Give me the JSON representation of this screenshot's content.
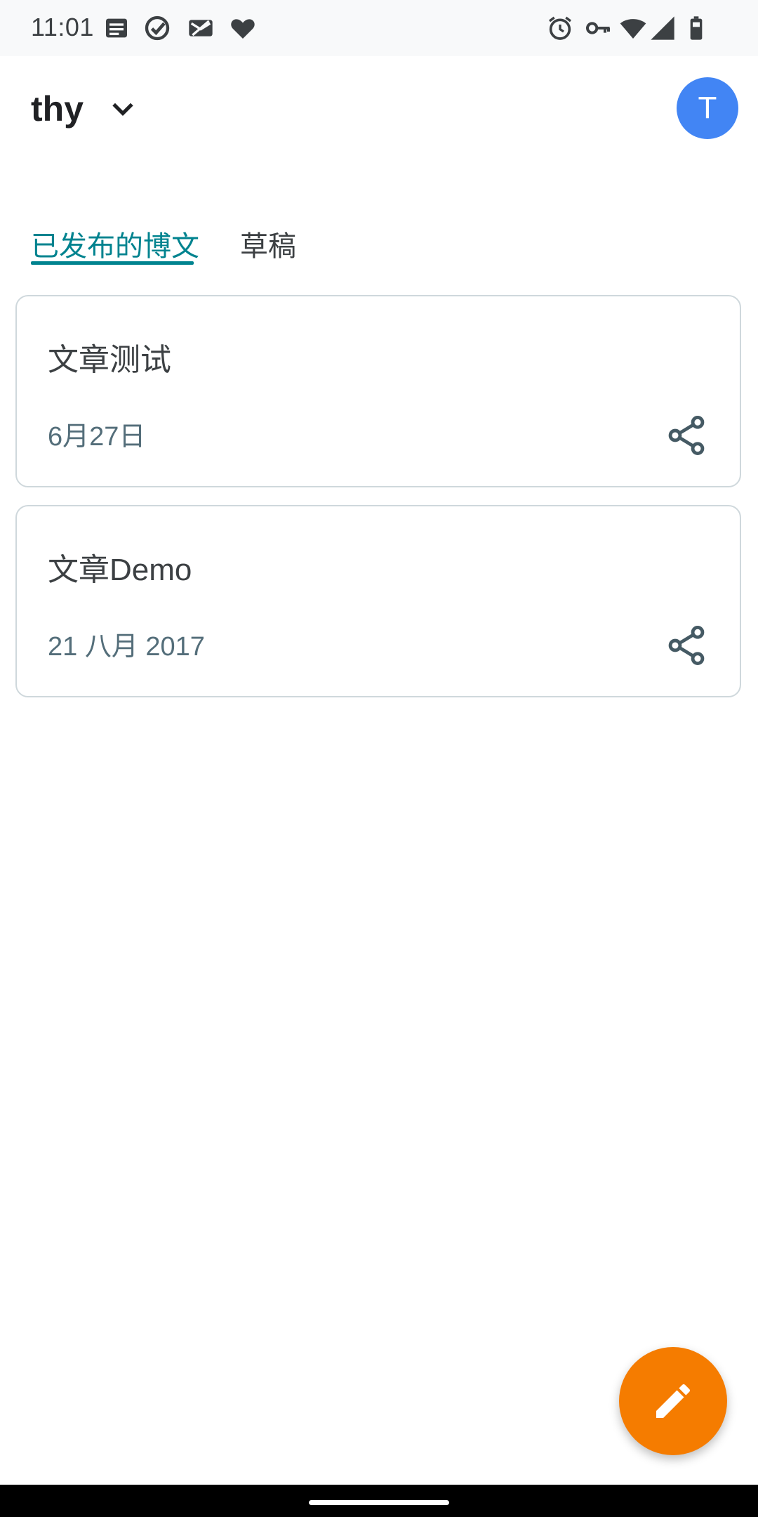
{
  "status_bar": {
    "time": "11:01",
    "left_icons": [
      "notes-icon",
      "check-circle-icon",
      "mail-off-icon",
      "heart-icon"
    ],
    "right_icons": [
      "alarm-icon",
      "vpn-key-icon",
      "wifi-icon",
      "cellular-signal-icon",
      "battery-icon"
    ]
  },
  "app_bar": {
    "blog_name": "thy",
    "avatar_initial": "T",
    "avatar_color": "#4285f4"
  },
  "tabs": [
    {
      "label": "已发布的博文",
      "selected": true
    },
    {
      "label": "草稿",
      "selected": false
    }
  ],
  "posts": [
    {
      "title": "文章测试",
      "date": "6月27日",
      "share_icon": "share-icon"
    },
    {
      "title": "文章Demo",
      "date": "21 八月 2017",
      "share_icon": "share-icon"
    }
  ],
  "fab": {
    "icon": "edit-pencil-icon",
    "color": "#f57c00"
  },
  "colors": {
    "accent": "#00838f",
    "fab": "#f57c00",
    "avatar": "#4285f4"
  }
}
